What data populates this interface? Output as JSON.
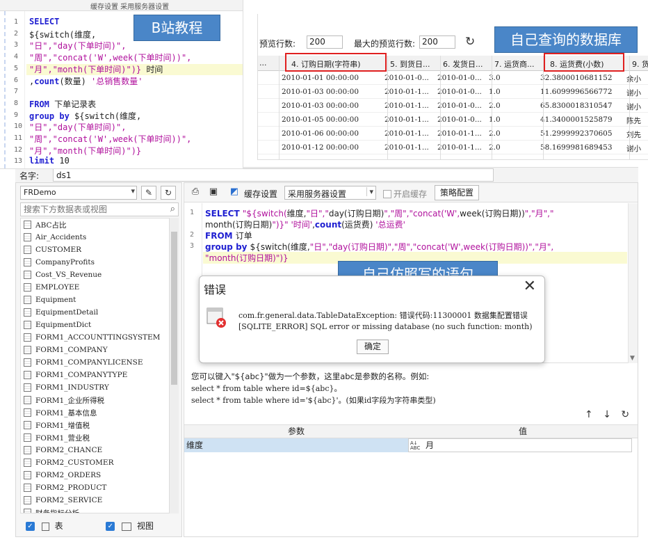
{
  "designer": {
    "name_label": "名字:",
    "name_value": "ds1",
    "datasource": "FRDemo",
    "search_placeholder": "搜索下方数据表或视图",
    "tables": [
      "ABC占比",
      "Air_Accidents",
      "CUSTOMER",
      "CompanyProfits",
      "Cost_VS_Revenue",
      "EMPLOYEE",
      "Equipment",
      "EquipmentDetail",
      "EquipmentDict",
      "FORM1_ACCOUNTTINGSYSTEM",
      "FORM1_COMPANY",
      "FORM1_COMPANYLICENSE",
      "FORM1_COMPANYTYPE",
      "FORM1_INDUSTRY",
      "FORM1_企业所得税",
      "FORM1_基本信息",
      "FORM1_增值税",
      "FORM1_营业税",
      "FORM2_CHANCE",
      "FORM2_CUSTOMER",
      "FORM2_ORDERS",
      "FORM2_PRODUCT",
      "FORM2_SERVICE",
      "财务指标分析"
    ],
    "check_table": "表",
    "check_view": "视图",
    "toolbar": {
      "cache_settings": "缓存设置",
      "server_settings": "采用服务器设置",
      "open_cache": "开启缓存",
      "strategy": "策略配置"
    },
    "sql_lines": [
      {
        "num": "1",
        "parts": [
          {
            "t": "SELECT ",
            "c": "kw"
          },
          {
            "t": "\"${switch(",
            "c": "str"
          },
          {
            "t": "维度,",
            "c": ""
          },
          {
            "t": "\"日\",\"",
            "c": "str"
          },
          {
            "t": "day(订购日期)",
            "c": ""
          },
          {
            "t": "\",\"周\",\"",
            "c": "str"
          },
          {
            "t": "concat('W',",
            "c": "str"
          },
          {
            "t": "week(订购日期))",
            "c": ""
          },
          {
            "t": "\",\"月\",\"",
            "c": "str"
          }
        ]
      },
      {
        "num": "",
        "parts": [
          {
            "t": "month(订购日期)",
            "c": ""
          },
          {
            "t": "\")}\" '时间'",
            "c": "str"
          },
          {
            "t": ",",
            "c": ""
          },
          {
            "t": "count",
            "c": "kw"
          },
          {
            "t": "(运货费) ",
            "c": ""
          },
          {
            "t": "'总运费'",
            "c": "str"
          }
        ]
      },
      {
        "num": "2",
        "parts": [
          {
            "t": "FROM ",
            "c": "kw"
          },
          {
            "t": "订单",
            "c": ""
          }
        ]
      },
      {
        "num": "3",
        "parts": [
          {
            "t": "group by ",
            "c": "kw"
          },
          {
            "t": "${switch(维度,",
            "c": ""
          },
          {
            "t": "\"日\",\"day(订购日期)\",\"周\",\"concat('W',week(订购日期))\",\"月\",",
            "c": "str"
          }
        ]
      },
      {
        "num": "",
        "parts": [
          {
            "t": "\"month(订购日期)\")}",
            "c": "str"
          }
        ]
      }
    ],
    "hint_line1": "您可以键入\"${abc}\"做为一个参数，这里abc是参数的名称。例如:",
    "hint_line2": "select * from table where id=${abc}。",
    "hint_line3": "select * from table where id='${abc}'。(如果id字段为字符串类型)",
    "param_header": "参数",
    "value_header": "值",
    "param_name": "维度",
    "param_value": "月"
  },
  "bz_snippet": {
    "toolbar_text": "缓存设置    采用服务器设置",
    "lines": [
      {
        "num": "1",
        "parts": [
          {
            "t": "SELECT",
            "c": "kw"
          }
        ]
      },
      {
        "num": "2",
        "parts": [
          {
            "t": "${switch(维度,",
            "c": ""
          }
        ]
      },
      {
        "num": "3",
        "parts": [
          {
            "t": "\"日\",\"day(下单时间)\",",
            "c": "str"
          }
        ]
      },
      {
        "num": "4",
        "parts": [
          {
            "t": "\"周\",\"concat('W',week(下单时间))\",",
            "c": "str"
          }
        ]
      },
      {
        "num": "5",
        "parts": [
          {
            "t": "\"月\",\"month(下单时间)\")}",
            "c": "str"
          },
          {
            "t": " 时间",
            "c": ""
          }
        ]
      },
      {
        "num": "6",
        "parts": [
          {
            "t": ",",
            "c": ""
          },
          {
            "t": "count",
            "c": "kw"
          },
          {
            "t": "(数量) ",
            "c": ""
          },
          {
            "t": "'总销售数量'",
            "c": "str"
          }
        ]
      },
      {
        "num": "7",
        "parts": []
      },
      {
        "num": "8",
        "parts": [
          {
            "t": "FROM ",
            "c": "kw"
          },
          {
            "t": "下单记录表",
            "c": ""
          }
        ]
      },
      {
        "num": "9",
        "parts": [
          {
            "t": "group by ",
            "c": "kw"
          },
          {
            "t": "${switch(维度,",
            "c": ""
          }
        ]
      },
      {
        "num": "10",
        "parts": [
          {
            "t": "\"日\",\"day(下单时间)\",",
            "c": "str"
          }
        ]
      },
      {
        "num": "11",
        "parts": [
          {
            "t": "\"周\",\"concat('W',week(下单时间))\",",
            "c": "str"
          }
        ]
      },
      {
        "num": "12",
        "parts": [
          {
            "t": "\"月\",\"month(下单时间)\")}",
            "c": "str"
          }
        ]
      },
      {
        "num": "13",
        "parts": [
          {
            "t": "limit ",
            "c": "kw"
          },
          {
            "t": "10",
            "c": ""
          }
        ]
      }
    ]
  },
  "query_result": {
    "preview_label": "预览行数:",
    "preview_value": "200",
    "max_preview_label": "最大的预览行数:",
    "max_preview_value": "200",
    "columns": [
      "...",
      "4. 订购日期(字符串)",
      "5. 到货日...",
      "6. 发货日...",
      "7. 运货商...",
      "8. 运货费(小数)",
      "9. 货"
    ],
    "rows": [
      [
        "2010-01-01 00:00:00",
        "2010-01-0...",
        "2010-01-0...",
        "3.0",
        "32.3800010681152",
        "余小"
      ],
      [
        "2010-01-03 00:00:00",
        "2010-01-1...",
        "2010-01-0...",
        "1.0",
        "11.6099996566772",
        "谢小"
      ],
      [
        "2010-01-03 00:00:00",
        "2010-01-1...",
        "2010-01-0...",
        "2.0",
        "65.8300018310547",
        "谢小"
      ],
      [
        "2010-01-05 00:00:00",
        "2010-01-1...",
        "2010-01-0...",
        "1.0",
        "41.3400001525879",
        "陈先"
      ],
      [
        "2010-01-06 00:00:00",
        "2010-01-1...",
        "2010-01-1...",
        "2.0",
        "51.2999992370605",
        "刘先"
      ],
      [
        "2010-01-12 00:00:00",
        "2010-01-1...",
        "2010-01-1...",
        "2.0",
        "58.1699981689453",
        "谢小"
      ]
    ]
  },
  "callouts": {
    "bz": "B站教程",
    "own_db": "自己查询的数据库",
    "own_sql": "自己仿照写的语句"
  },
  "error_dialog": {
    "title": "错误",
    "line1": "com.fr.general.data.TableDataException: 错误代码:11300001 数据集配置错误",
    "line2": "[SQLITE_ERROR] SQL error or missing database (no such function: month)",
    "ok": "确定"
  },
  "colors": {
    "callout_bg": "#4a86c8",
    "keyword": "#1f1fd1",
    "string": "#b0109c",
    "highlight": "#fafad2",
    "red_box": "#e02020"
  }
}
